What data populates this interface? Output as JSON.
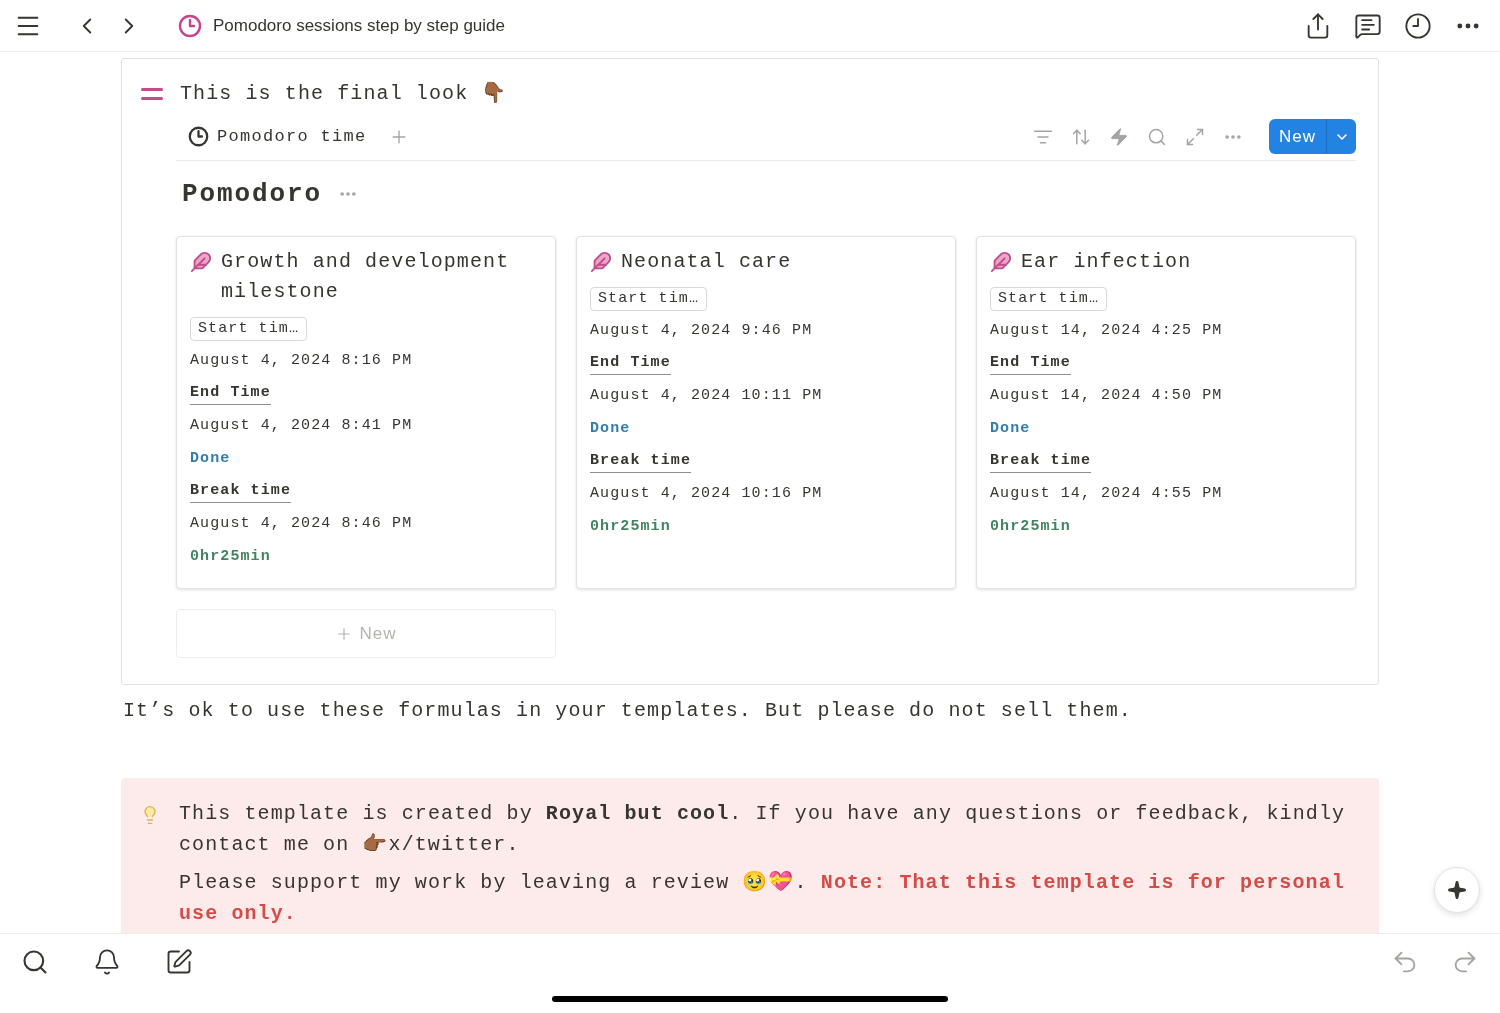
{
  "top_bar": {
    "title": "Pomodoro sessions step by step guide"
  },
  "toggle": {
    "title": "This is the final look 👇🏾",
    "database": {
      "tabs": [
        {
          "label": "Pomodoro time",
          "selected": true
        }
      ],
      "new_button": "New",
      "title": "Pomodoro",
      "cards": [
        {
          "title": "Growth and development milestone",
          "properties": [
            {
              "kind": "tag",
              "text": "Start tim…"
            },
            {
              "kind": "date",
              "text": "August 4, 2024 8:16 PM"
            },
            {
              "kind": "label",
              "text": "End Time"
            },
            {
              "kind": "date",
              "text": "August 4, 2024 8:41 PM"
            },
            {
              "kind": "status",
              "text": "Done"
            },
            {
              "kind": "label",
              "text": "Break time"
            },
            {
              "kind": "date",
              "text": "August 4, 2024 8:46 PM"
            },
            {
              "kind": "duration",
              "text": "0hr25min"
            }
          ]
        },
        {
          "title": "Neonatal care",
          "properties": [
            {
              "kind": "tag",
              "text": "Start tim…"
            },
            {
              "kind": "date",
              "text": "August 4, 2024 9:46 PM"
            },
            {
              "kind": "label",
              "text": "End Time"
            },
            {
              "kind": "date",
              "text": "August 4, 2024 10:11 PM"
            },
            {
              "kind": "status",
              "text": "Done"
            },
            {
              "kind": "label",
              "text": "Break time"
            },
            {
              "kind": "date",
              "text": "August 4, 2024 10:16 PM"
            },
            {
              "kind": "duration",
              "text": "0hr25min"
            }
          ]
        },
        {
          "title": "Ear infection",
          "properties": [
            {
              "kind": "tag",
              "text": "Start tim…"
            },
            {
              "kind": "date",
              "text": "August 14, 2024 4:25 PM"
            },
            {
              "kind": "label",
              "text": "End Time"
            },
            {
              "kind": "date",
              "text": "August 14, 2024 4:50 PM"
            },
            {
              "kind": "status",
              "text": "Done"
            },
            {
              "kind": "label",
              "text": "Break time"
            },
            {
              "kind": "date",
              "text": "August 14, 2024 4:55 PM"
            },
            {
              "kind": "duration",
              "text": "0hr25min"
            }
          ]
        }
      ],
      "add_card": "New"
    }
  },
  "paragraph": "It’s ok to use these formulas in your templates. But please do not sell them.",
  "callout": {
    "paragraphs": [
      [
        {
          "kind": "plain",
          "text": "This template is created by **Royal but cool**. If you have any questions or feedback, kindly contact me on 👉🏾x/twitter."
        }
      ],
      [
        {
          "kind": "plain",
          "text": "Please support my work by leaving a review 🥹💝."
        },
        {
          "kind": "note",
          "text": "Note: That this template is for personal use only."
        }
      ]
    ]
  }
}
